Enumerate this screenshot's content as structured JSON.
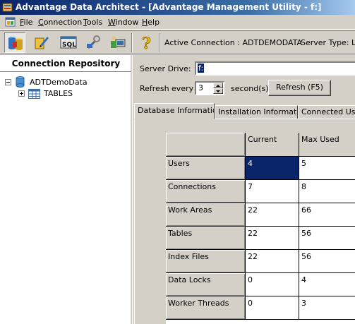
{
  "window": {
    "title": "Advantage Data Architect - [Advantage Management Utility - f:]"
  },
  "menu": [
    "File",
    "Connection",
    "Tools",
    "Window",
    "Help"
  ],
  "toolbar": {
    "active_connection": "Active Connection : ADTDEMODATA",
    "server_type": "Server Type: LO"
  },
  "repository": {
    "title": "Connection Repository",
    "root": "ADTDemoData",
    "child": "TABLES"
  },
  "form": {
    "server_drive_label": "Server Drive:",
    "server_drive_value": "f:",
    "refresh_label": "Refresh every",
    "refresh_value": "3",
    "seconds_label": "second(s)",
    "refresh_button": "Refresh (F5)"
  },
  "tabs": [
    "Database Information",
    "Installation Information",
    "Connected Users"
  ],
  "grid": {
    "columns": [
      "Current",
      "Max Used"
    ],
    "rows": [
      {
        "label": "Users",
        "current": "4",
        "max": "5"
      },
      {
        "label": "Connections",
        "current": "7",
        "max": "8"
      },
      {
        "label": "Work Areas",
        "current": "22",
        "max": "66"
      },
      {
        "label": "Tables",
        "current": "22",
        "max": "56"
      },
      {
        "label": "Index Files",
        "current": "22",
        "max": "56"
      },
      {
        "label": "Data Locks",
        "current": "0",
        "max": "4"
      },
      {
        "label": "Worker Threads",
        "current": "0",
        "max": "3"
      }
    ]
  }
}
